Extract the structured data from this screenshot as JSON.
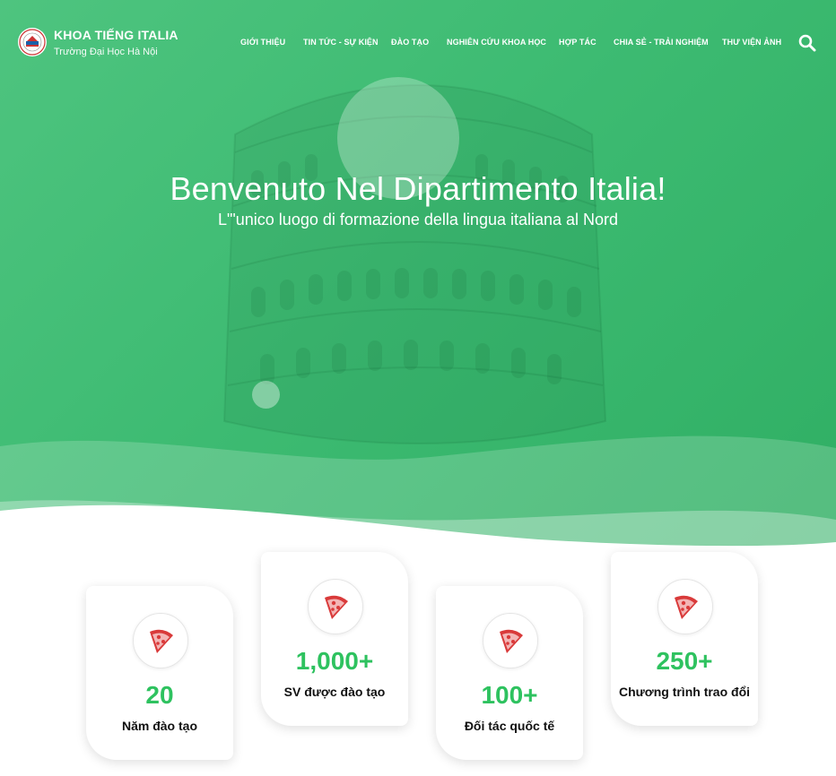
{
  "brand": {
    "title": "KHOA TIẾNG ITALIA",
    "subtitle": "Trường Đại Học Hà Nội"
  },
  "nav": {
    "items": [
      {
        "label": "GIỚI THIỆU"
      },
      {
        "label": "TIN TỨC - SỰ KIỆN"
      },
      {
        "label": "ĐÀO TẠO"
      },
      {
        "label": "NGHIÊN CỨU KHOA HỌC"
      },
      {
        "label": "HỢP TÁC"
      },
      {
        "label": "CHIA SẺ - TRẢI NGHIỆM"
      },
      {
        "label": "THƯ VIỆN ẢNH"
      }
    ],
    "search_icon": "search-icon"
  },
  "hero": {
    "title": "Benvenuto Nel Dipartimento Italia!",
    "subtitle": "L\"'unico luogo di formazione della lingua italiana al Nord"
  },
  "stats": [
    {
      "value": "20",
      "label": "Năm đào tạo",
      "icon": "pizza-icon"
    },
    {
      "value": "1,000+",
      "label": "SV được đào tạo",
      "icon": "pizza-icon"
    },
    {
      "value": "100+",
      "label": "Đối tác quốc tế",
      "icon": "pizza-icon"
    },
    {
      "value": "250+",
      "label": "Chương trình trao đổi",
      "icon": "pizza-icon"
    }
  ],
  "colors": {
    "hero_green": "#3dbb72",
    "stat_green": "#2ec25f",
    "pizza_red": "#d93a3a"
  }
}
